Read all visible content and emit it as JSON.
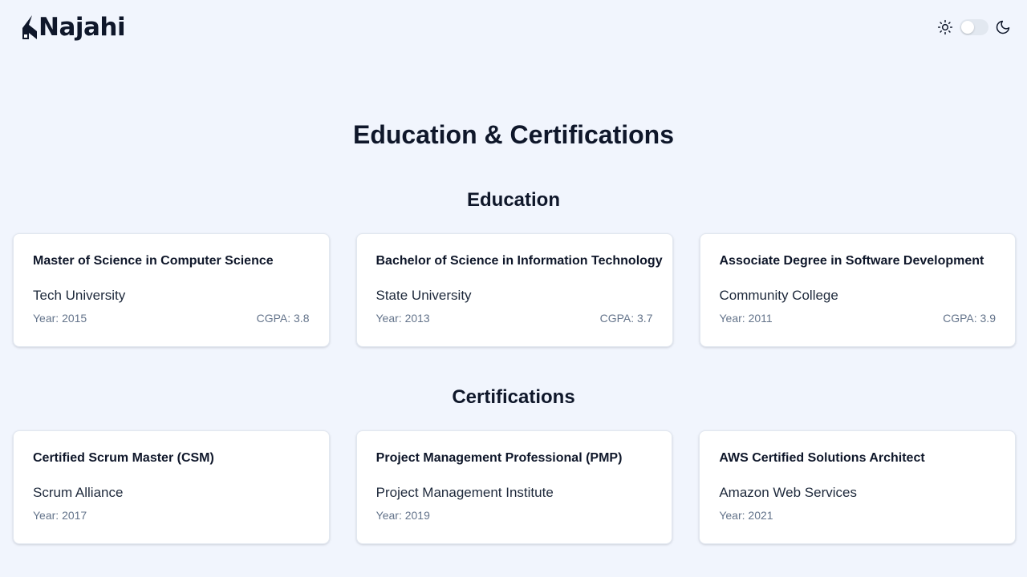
{
  "header": {
    "logo_text": "Najahi",
    "theme": {
      "light_icon": "sun-icon",
      "dark_icon": "moon-icon",
      "mode": "light"
    }
  },
  "page": {
    "title": "Education & Certifications"
  },
  "education": {
    "title": "Education",
    "items": [
      {
        "degree": "Master of Science in Computer Science",
        "institution": "Tech University",
        "year": "Year: 2015",
        "cgpa": "CGPA: 3.8"
      },
      {
        "degree": "Bachelor of Science in Information Technology",
        "institution": "State University",
        "year": "Year: 2013",
        "cgpa": "CGPA: 3.7"
      },
      {
        "degree": "Associate Degree in Software Development",
        "institution": "Community College",
        "year": "Year: 2011",
        "cgpa": "CGPA: 3.9"
      }
    ]
  },
  "certifications": {
    "title": "Certifications",
    "items": [
      {
        "name": "Certified Scrum Master (CSM)",
        "issuer": "Scrum Alliance",
        "year": "Year: 2017"
      },
      {
        "name": "Project Management Professional (PMP)",
        "issuer": "Project Management Institute",
        "year": "Year: 2019"
      },
      {
        "name": "AWS Certified Solutions Architect",
        "issuer": "Amazon Web Services",
        "year": "Year: 2021"
      }
    ]
  },
  "colors": {
    "background": "#f1f5fd",
    "text": "#0f172a",
    "muted": "#64748b",
    "card": "#ffffff"
  }
}
